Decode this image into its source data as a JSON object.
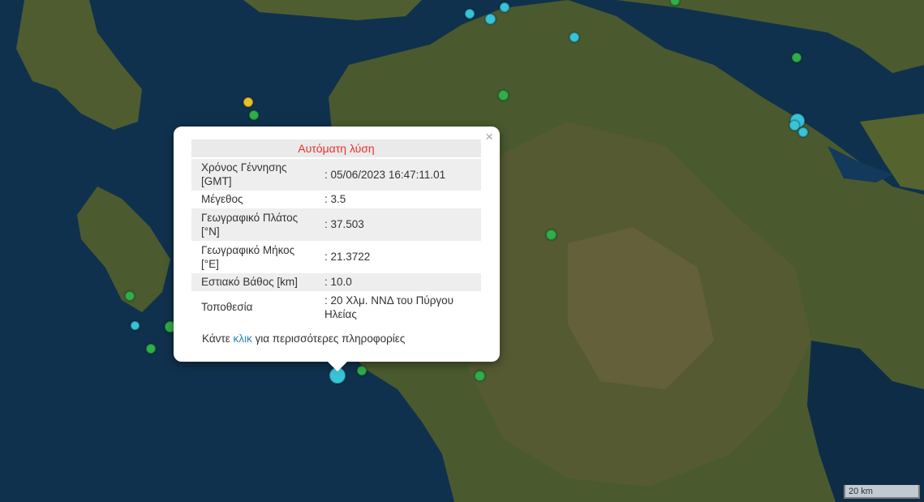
{
  "popup": {
    "title": "Αυτόματη λύση",
    "close_label": "×",
    "rows": [
      {
        "label": "Χρόνος Γέννησης [GMT]",
        "value": ": 05/06/2023 16:47:11.01"
      },
      {
        "label": "Μέγεθος",
        "value": ": 3.5"
      },
      {
        "label": "Γεωγραφικό Πλάτος [°N]",
        "value": ": 37.503"
      },
      {
        "label": "Γεωγραφικό Μήκος [°E]",
        "value": ": 21.3722"
      },
      {
        "label": "Εστιακό Βάθος [km]",
        "value": ": 10.0"
      },
      {
        "label": "Τοποθεσία",
        "value": ": 20 Χλμ. ΝΝΔ του Πύργου Ηλείας"
      }
    ],
    "more_prefix": "Κάντε ",
    "more_link": "κλικ",
    "more_suffix": " για περισσότερες πληροφορίες"
  },
  "scale_bar": {
    "label": "20 km"
  },
  "colors": {
    "green_marker": "#2fae4a",
    "cyan_marker": "#39c3d8",
    "yellow_marker": "#e8c02d",
    "title": "#e8302b",
    "link": "#2a84c4"
  }
}
